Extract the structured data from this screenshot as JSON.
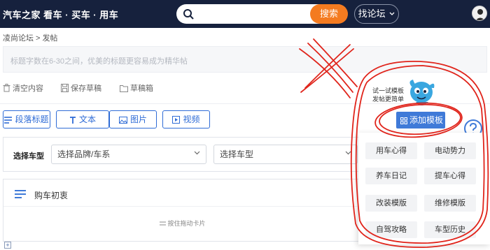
{
  "header": {
    "logo_brand": "汽车之家",
    "logo_slogan": "看车 · 买车 · 用车",
    "search_placeholder": "",
    "search_button": "搜索",
    "forum_button": "找论坛"
  },
  "breadcrumb": {
    "forum": "凌尚论坛",
    "separator": ">",
    "current": "发帖"
  },
  "title_input": {
    "placeholder": "标题字数在6-30之间，优美的标题更容易成为精华帖"
  },
  "toolbar": {
    "clear": "清空内容",
    "save_draft": "保存草稿",
    "drafts": "草稿箱"
  },
  "insert_buttons": {
    "paragraph_title": "段落标题",
    "text": "文本",
    "image": "图片",
    "video": "视频"
  },
  "vehicle_select": {
    "label": "选择车型",
    "brand_placeholder": "选择品牌/车系",
    "model_placeholder": "选择车型"
  },
  "card": {
    "title": "购车初衷",
    "drag_hint": "按住拖动卡片",
    "add_symbol": "+"
  },
  "template": {
    "tip_line1": "试一试模板",
    "tip_line2": "发帖更简单",
    "add_button": "添加模板",
    "items": [
      "用车心得",
      "电动势力",
      "养车日记",
      "提车心得",
      "改装模版",
      "维修模版",
      "自驾攻略",
      "车型历史"
    ]
  },
  "colors": {
    "header_bg": "#16213d",
    "search_orange": "#f47b20",
    "accent_blue": "#2f6cd6",
    "annotation_red": "#e0241b"
  }
}
